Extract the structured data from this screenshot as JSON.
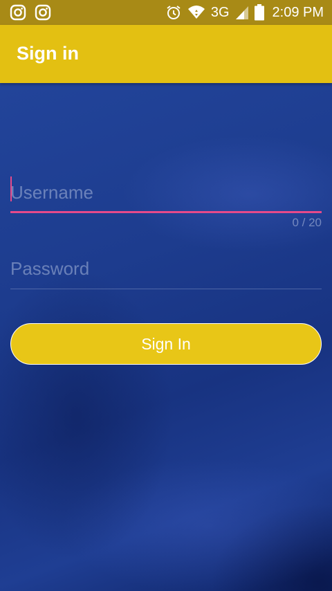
{
  "status_bar": {
    "time": "2:09 PM",
    "network": "3G",
    "icons": [
      "instagram-icon",
      "instagram-icon",
      "alarm-icon",
      "wifi-icon",
      "signal-icon",
      "battery-icon"
    ]
  },
  "app_bar": {
    "title": "Sign in"
  },
  "form": {
    "username": {
      "placeholder": "Username",
      "value": "",
      "counter": "0 / 20"
    },
    "password": {
      "placeholder": "Password",
      "value": ""
    },
    "sign_in_label": "Sign In"
  },
  "colors": {
    "app_bar": "#e3c012",
    "status_bar": "#a88a16",
    "accent": "#e64a8a",
    "button": "#e8c617",
    "background": "#1b3a8c"
  }
}
